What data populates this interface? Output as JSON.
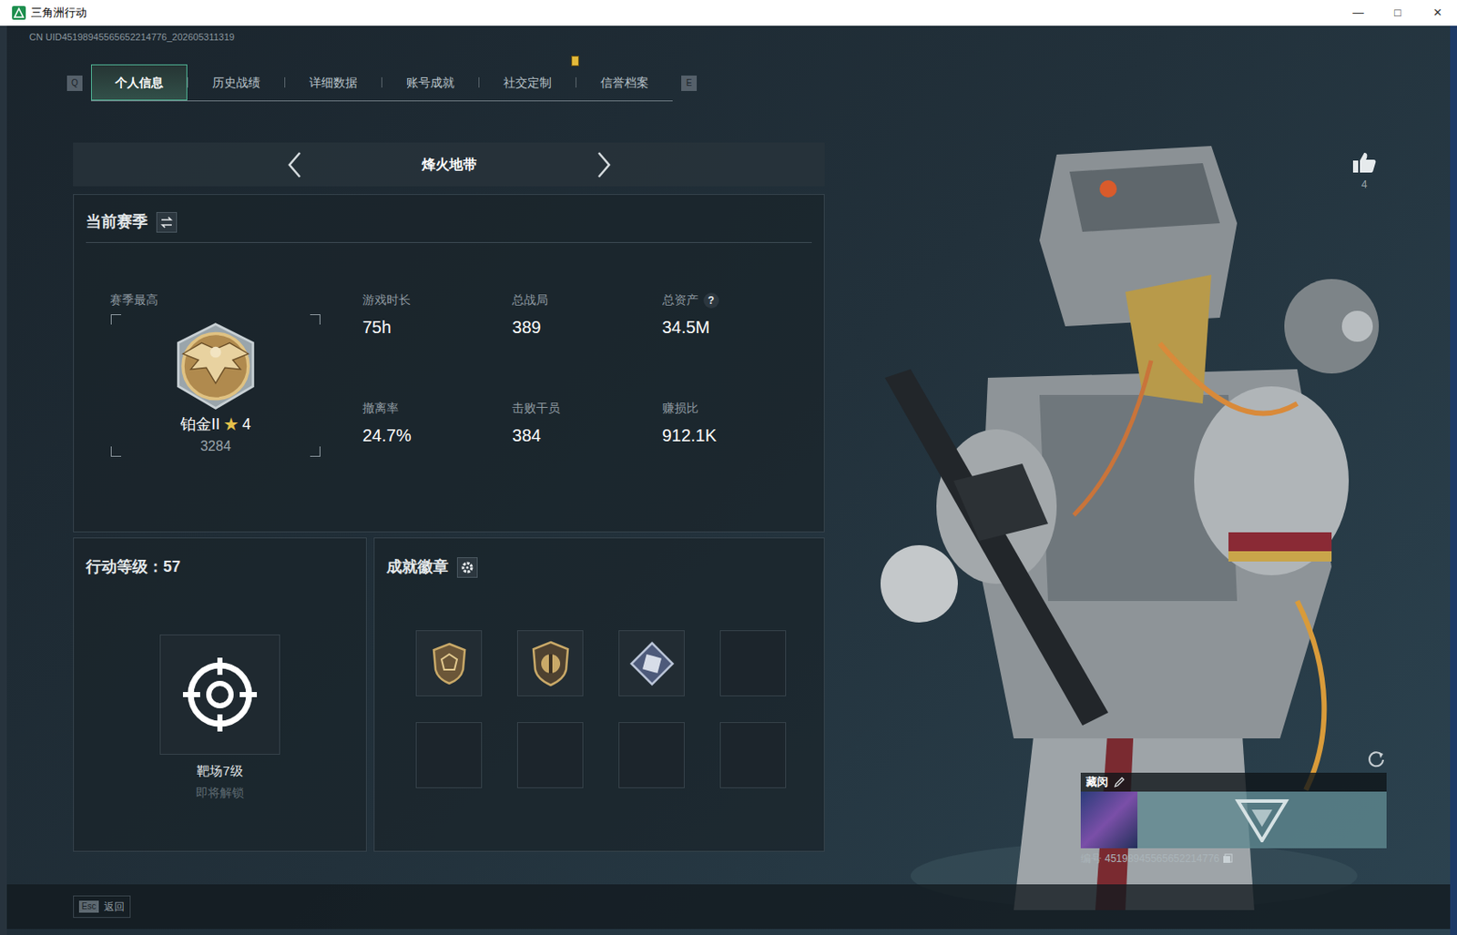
{
  "window": {
    "title": "三角洲行动",
    "controls": [
      "—",
      "□",
      "✕"
    ]
  },
  "uid": "CN UID45198945565652214776_202605311319",
  "tabs": {
    "prev_key": "Q",
    "next_key": "E",
    "items": [
      {
        "label": "个人信息",
        "selected": true,
        "notice": false
      },
      {
        "label": "历史战绩",
        "selected": false,
        "notice": false
      },
      {
        "label": "详细数据",
        "selected": false,
        "notice": false
      },
      {
        "label": "账号成就",
        "selected": false,
        "notice": false
      },
      {
        "label": "社交定制",
        "selected": false,
        "notice": true
      },
      {
        "label": "信誉档案",
        "selected": false,
        "notice": false
      }
    ]
  },
  "mode": {
    "label": "烽火地带"
  },
  "season": {
    "title": "当前赛季",
    "best_label": "赛季最高",
    "rank": "铂金II",
    "star": "★",
    "star_count": "4",
    "score": "3284",
    "stats": [
      {
        "label": "游戏时长",
        "value": "75h"
      },
      {
        "label": "总战局",
        "value": "389"
      },
      {
        "label": "总资产",
        "value": "34.5M",
        "hint": "?"
      },
      {
        "label": "撤离率",
        "value": "24.7%"
      },
      {
        "label": "击败干员",
        "value": "384"
      },
      {
        "label": "赚损比",
        "value": "912.1K"
      }
    ]
  },
  "level": {
    "label": "行动等级：",
    "value": "57",
    "next_unlock": "靶场7级",
    "unlock_status": "即将解锁"
  },
  "badges": {
    "title": "成就徽章",
    "slots": [
      {
        "kind": "bronze-shield"
      },
      {
        "kind": "bronze-emblem"
      },
      {
        "kind": "silver-diamond"
      },
      {
        "kind": "empty"
      },
      {
        "kind": "empty"
      },
      {
        "kind": "empty"
      },
      {
        "kind": "empty"
      },
      {
        "kind": "empty"
      }
    ]
  },
  "likes": {
    "count": "4"
  },
  "card": {
    "name": "藏闵",
    "id_label": "编号",
    "id": "45198945565652214776"
  },
  "bottom": {
    "key": "Esc",
    "label": "返回"
  }
}
